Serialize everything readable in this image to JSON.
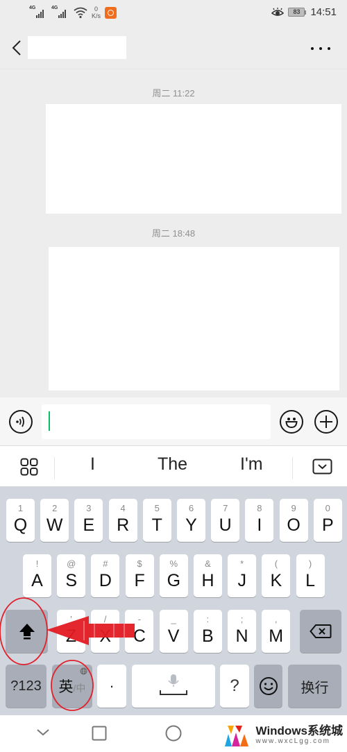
{
  "status_bar": {
    "signal1_label": "4G",
    "signal2_label": "4G",
    "speed_value": "0",
    "speed_unit": "K/s",
    "battery_level": "83",
    "time": "14:51"
  },
  "title_bar": {
    "back_icon": "chevron-left-icon",
    "title": "",
    "more_icon": "more-dots-icon"
  },
  "chat": {
    "messages": [
      {
        "timestamp": "周二 11:22",
        "content": ""
      },
      {
        "timestamp": "周二 18:48",
        "content": ""
      }
    ]
  },
  "input_bar": {
    "voice_icon": "voice-icon",
    "input_value": "",
    "emoji_icon": "emoji-icon",
    "plus_icon": "plus-icon",
    "caret_color": "#07c160"
  },
  "suggestions": {
    "menu_icon": "grid-icon",
    "items": [
      "I",
      "The",
      "I'm"
    ],
    "collapse_icon": "keyboard-hide-icon"
  },
  "keyboard": {
    "row1": [
      {
        "main": "Q",
        "sub": "1"
      },
      {
        "main": "W",
        "sub": "2"
      },
      {
        "main": "E",
        "sub": "3"
      },
      {
        "main": "R",
        "sub": "4"
      },
      {
        "main": "T",
        "sub": "5"
      },
      {
        "main": "Y",
        "sub": "6"
      },
      {
        "main": "U",
        "sub": "7"
      },
      {
        "main": "I",
        "sub": "8"
      },
      {
        "main": "O",
        "sub": "9"
      },
      {
        "main": "P",
        "sub": "0"
      }
    ],
    "row2": [
      {
        "main": "A",
        "sub": "!"
      },
      {
        "main": "S",
        "sub": "@"
      },
      {
        "main": "D",
        "sub": "#"
      },
      {
        "main": "F",
        "sub": "$"
      },
      {
        "main": "G",
        "sub": "%"
      },
      {
        "main": "H",
        "sub": "&"
      },
      {
        "main": "J",
        "sub": "*"
      },
      {
        "main": "K",
        "sub": "("
      },
      {
        "main": "L",
        "sub": ")"
      }
    ],
    "row3": [
      {
        "main": "Z",
        "sub": "'"
      },
      {
        "main": "X",
        "sub": "/"
      },
      {
        "main": "C",
        "sub": "-"
      },
      {
        "main": "V",
        "sub": "_"
      },
      {
        "main": "B",
        "sub": ":"
      },
      {
        "main": "N",
        "sub": ";"
      },
      {
        "main": "M",
        "sub": ","
      }
    ],
    "shift_icon": "shift-arrow-icon",
    "backspace_icon": "backspace-icon",
    "num_label": "?123",
    "lang_primary": "英",
    "lang_secondary": "/中",
    "globe_icon": "globe-icon",
    "period_label": "·",
    "space_icon": "mic-space-icon",
    "question_label": "?",
    "emoji_icon": "smiley-icon",
    "enter_label": "换行"
  },
  "nav_bar": {
    "back_icon": "chevron-down-icon",
    "recents_icon": "square-icon",
    "home_icon": "circle-icon"
  },
  "annotations": {
    "highlight_color": "#e0202a",
    "arrow_color": "#e31b23"
  },
  "watermark": {
    "title": "Windows系统城",
    "url": "www.wxcLgg.com"
  }
}
